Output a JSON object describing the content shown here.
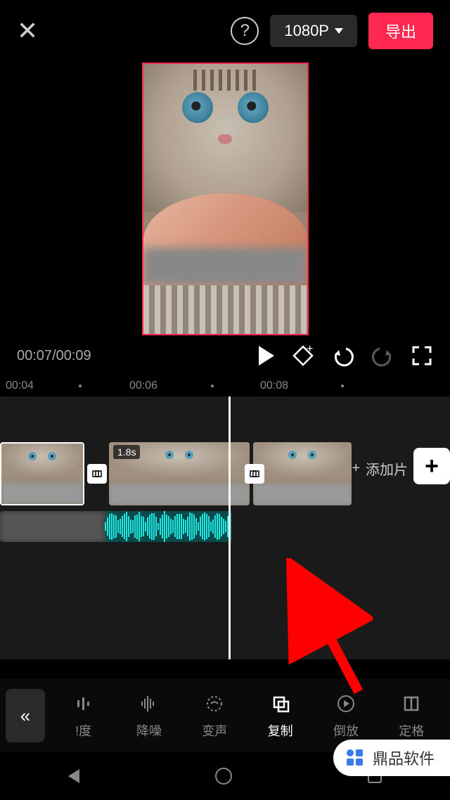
{
  "header": {
    "resolution": "1080P",
    "export": "导出"
  },
  "playback": {
    "current": "00:07",
    "total": "00:09"
  },
  "ruler": {
    "t1": "00:04",
    "t2": "00:06",
    "t3": "00:08"
  },
  "timeline": {
    "clip2_duration": "1.8s",
    "add_clip": "添加片"
  },
  "tools": {
    "t1": "!度",
    "t2": "降噪",
    "t3": "变声",
    "t4": "复制",
    "t5": "倒放",
    "t6": "定格"
  },
  "watermark": "鼎品软件"
}
